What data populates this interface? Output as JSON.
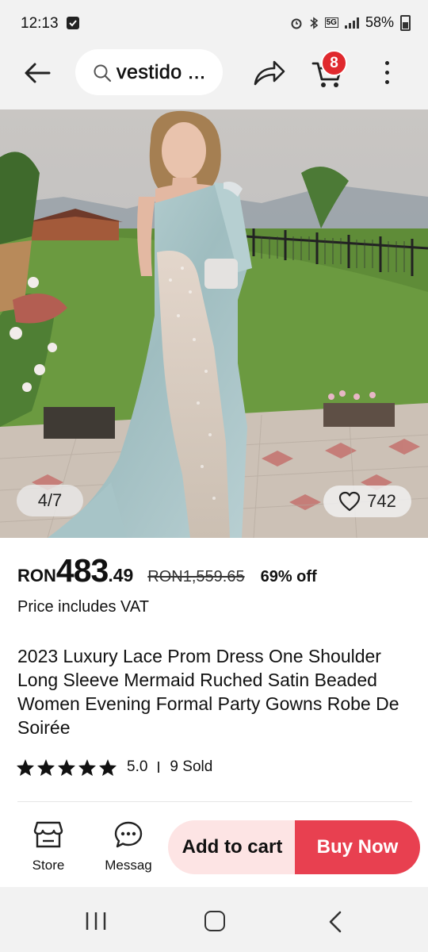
{
  "status": {
    "time": "12:13",
    "network": "5G",
    "battery": "58%"
  },
  "topbar": {
    "search_text": "vestido ...",
    "cart_count": "8"
  },
  "gallery": {
    "counter": "4/7",
    "likes": "742"
  },
  "price": {
    "currency": "RON",
    "integer": "483",
    "decimal": ".49",
    "original": "RON1,559.65",
    "discount": "69% off",
    "vat_note": "Price includes VAT"
  },
  "product": {
    "title": "2023 Luxury Lace Prom Dress One Shoulder Long Sleeve Mermaid Ruched Satin Beaded Women Evening Formal Party Gowns Robe De Soirée",
    "rating": "5.0",
    "sold": "9 Sold",
    "stars": 5
  },
  "actions": {
    "store": "Store",
    "message": "Messag",
    "add_to_cart": "Add to cart",
    "buy_now": "Buy Now"
  },
  "icons": [
    "back-arrow-icon",
    "search-icon",
    "share-icon",
    "cart-icon",
    "more-icon",
    "heart-icon",
    "star-icon",
    "store-icon",
    "message-icon",
    "recent-apps-icon",
    "home-icon",
    "back-nav-icon"
  ],
  "colors": {
    "accent": "#e84050",
    "badge": "#e0292e",
    "add_to_cart_bg": "#fde4e4"
  }
}
